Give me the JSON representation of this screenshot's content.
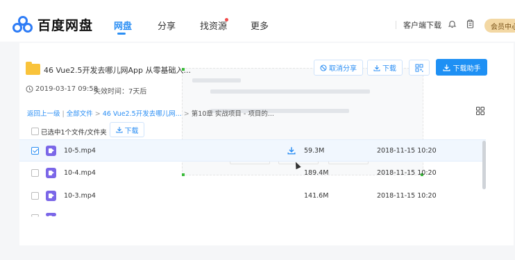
{
  "brand": {
    "name": "百度网盘"
  },
  "nav": {
    "items": [
      "网盘",
      "分享",
      "找资源",
      "更多"
    ]
  },
  "topbar": {
    "client_download": "客户端下载",
    "vip": "会员中心"
  },
  "share": {
    "title": "46 Vue2.5开发去哪儿网App 从零基础入...",
    "cancel_share": "取消分享",
    "download": "下载",
    "download_helper": "下载助手",
    "date": "2019-03-17 09:58",
    "expiry": "失效时间：7天后"
  },
  "breadcrumb": {
    "back": "返回上一级",
    "all_files": "全部文件",
    "sep": " | ",
    "arrow": " > ",
    "folder": "46 Vue2.5开发去哪儿网...",
    "current": "第10章 实战项目 - 项目的..."
  },
  "selection": {
    "label": "已选中1个文件/文件夹",
    "download": "下载"
  },
  "files": [
    {
      "name": "10-5.mp4",
      "size": "59.3M",
      "date": "2018-11-15 10:20",
      "checked": true
    },
    {
      "name": "10-4.mp4",
      "size": "189.4M",
      "date": "2018-11-15 10:20",
      "checked": false
    },
    {
      "name": "10-3.mp4",
      "size": "141.6M",
      "date": "2018-11-15 10:20",
      "checked": false
    }
  ],
  "colors": {
    "accent": "#2a8ef4",
    "video_icon": "#7b67e8",
    "folder": "#f9c33b",
    "vip": "#f3d8a4"
  },
  "icons": [
    "logo-icon",
    "bell-icon",
    "clipboard-icon",
    "folder-icon",
    "cancel-share-icon",
    "download-icon",
    "qrcode-icon",
    "clock-icon",
    "grid-view-icon",
    "video-file-icon",
    "mouse-cursor-icon"
  ]
}
